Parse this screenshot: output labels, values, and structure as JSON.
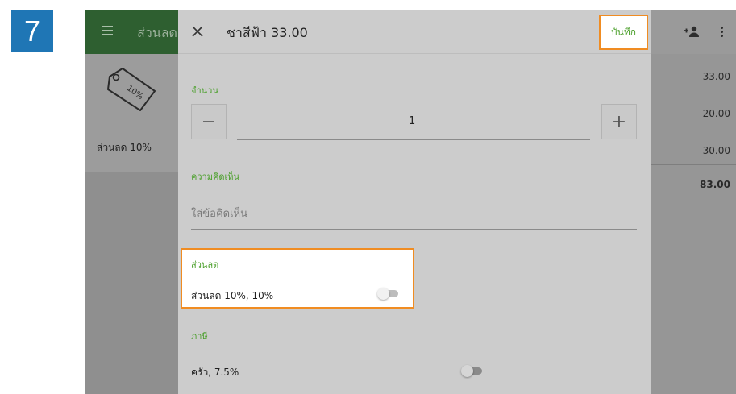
{
  "step": "7",
  "app": {
    "title": "ส่วนลด"
  },
  "discount_tile": {
    "label": "ส่วนลด 10%",
    "tag_text": "10%"
  },
  "prices": [
    "33.00",
    "20.00",
    "30.00"
  ],
  "total": "83.00",
  "dialog": {
    "title": "ชาสีฟ้า 33.00",
    "save_label": "บันทึก",
    "quantity": {
      "label": "จำนวน",
      "value": "1",
      "minus": "−",
      "plus": "+"
    },
    "comment": {
      "label": "ความคิดเห็น",
      "placeholder": "ใส่ข้อคิดเห็น"
    },
    "discount": {
      "label": "ส่วนลด",
      "item": "ส่วนลด 10%, 10%",
      "enabled": false
    },
    "tax": {
      "label": "ภาษี",
      "item": "ครัว, 7.5%",
      "enabled": false
    }
  },
  "colors": {
    "accent_green": "#4a9f2a",
    "highlight_orange": "#f08c22",
    "step_blue": "#1f76b5"
  },
  "icons": [
    "menu-icon",
    "close-icon",
    "add-person-icon",
    "more-vert-icon",
    "tag-icon"
  ]
}
